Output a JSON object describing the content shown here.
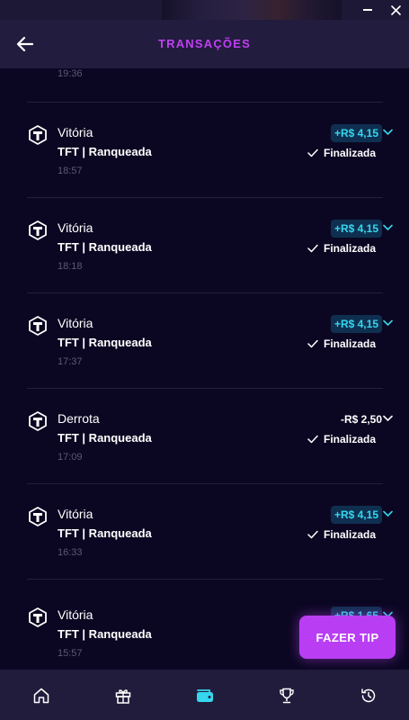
{
  "header": {
    "title": "TRANSAÇÕES"
  },
  "partial_item": {
    "time": "19:36"
  },
  "transactions": [
    {
      "result": "Vitória",
      "game": "TFT | Ranqueada",
      "time": "18:57",
      "amount": "+R$ 4,15",
      "status": "Finalizada",
      "positive": true
    },
    {
      "result": "Vitória",
      "game": "TFT | Ranqueada",
      "time": "18:18",
      "amount": "+R$ 4,15",
      "status": "Finalizada",
      "positive": true
    },
    {
      "result": "Vitória",
      "game": "TFT | Ranqueada",
      "time": "17:37",
      "amount": "+R$ 4,15",
      "status": "Finalizada",
      "positive": true
    },
    {
      "result": "Derrota",
      "game": "TFT | Ranqueada",
      "time": "17:09",
      "amount": "-R$ 2,50",
      "status": "Finalizada",
      "positive": false
    },
    {
      "result": "Vitória",
      "game": "TFT | Ranqueada",
      "time": "16:33",
      "amount": "+R$ 4,15",
      "status": "Finalizada",
      "positive": true
    },
    {
      "result": "Vitória",
      "game": "TFT | Ranqueada",
      "time": "15:57",
      "amount": "+R$ 1,65",
      "status": "",
      "positive": true
    }
  ],
  "tip_button": {
    "label": "FAZER TIP"
  },
  "nav": {
    "items": [
      "home-icon",
      "gift-icon",
      "wallet-icon",
      "trophy-icon",
      "history-icon"
    ],
    "active": "wallet-icon"
  },
  "colors": {
    "background": "#0b0722",
    "header": "#221c3e",
    "accent_purple": "#b93ef3",
    "title_purple": "#c23ff5",
    "positive_text": "#35d6ee",
    "positive_bg": "#0f2f50",
    "muted": "#5c5878"
  }
}
